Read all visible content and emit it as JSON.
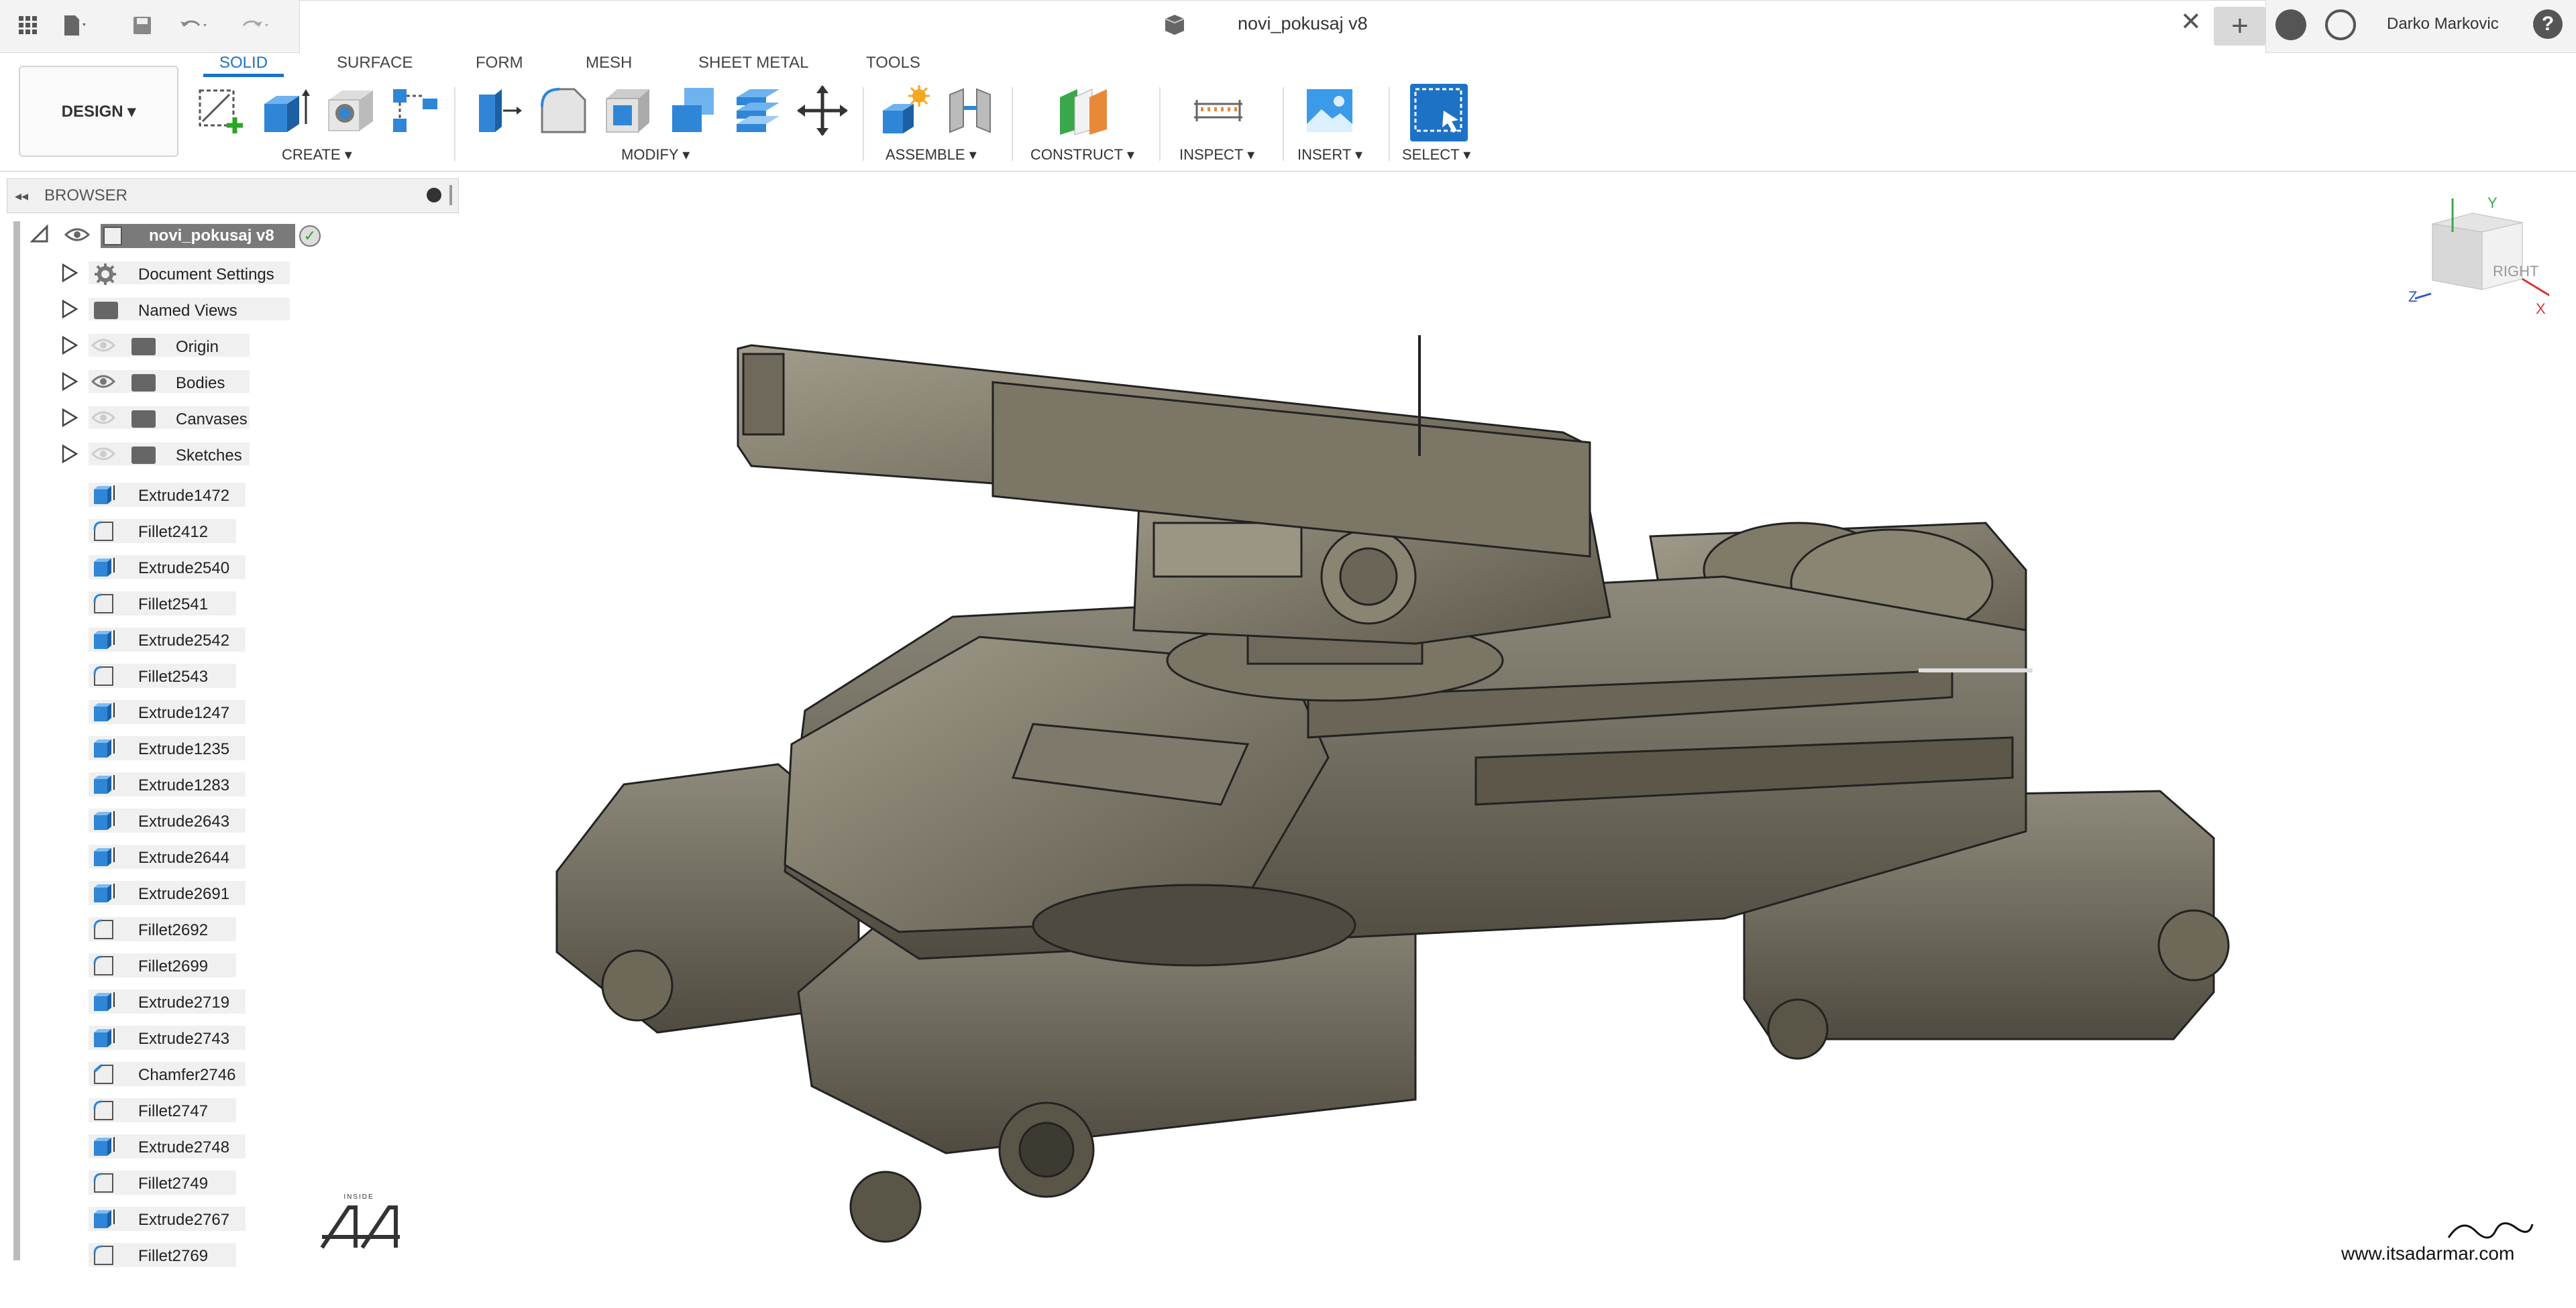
{
  "titlebar": {
    "document_title": "novi_pokusaj v8",
    "user_name": "Darko Markovic",
    "close_glyph": "✕",
    "add_glyph": "+",
    "help_glyph": "?"
  },
  "ribbon": {
    "workspace_label": "DESIGN ▾",
    "tabs": [
      "SOLID",
      "SURFACE",
      "FORM",
      "MESH",
      "SHEET METAL",
      "TOOLS"
    ],
    "active_tab": "SOLID",
    "groups": [
      "CREATE ▾",
      "MODIFY ▾",
      "ASSEMBLE ▾",
      "CONSTRUCT ▾",
      "INSPECT ▾",
      "INSERT ▾",
      "SELECT ▾"
    ]
  },
  "browser": {
    "title": "BROWSER",
    "root": "novi_pokusaj v8",
    "folders": [
      "Document Settings",
      "Named Views",
      "Origin",
      "Bodies",
      "Canvases",
      "Sketches"
    ],
    "features": [
      {
        "label": "Extrude1472",
        "type": "extrude"
      },
      {
        "label": "Fillet2412",
        "type": "fillet"
      },
      {
        "label": "Extrude2540",
        "type": "extrude"
      },
      {
        "label": "Fillet2541",
        "type": "fillet"
      },
      {
        "label": "Extrude2542",
        "type": "extrude"
      },
      {
        "label": "Fillet2543",
        "type": "fillet"
      },
      {
        "label": "Extrude1247",
        "type": "extrude"
      },
      {
        "label": "Extrude1235",
        "type": "extrude"
      },
      {
        "label": "Extrude1283",
        "type": "extrude"
      },
      {
        "label": "Extrude2643",
        "type": "extrude"
      },
      {
        "label": "Extrude2644",
        "type": "extrude"
      },
      {
        "label": "Extrude2691",
        "type": "extrude"
      },
      {
        "label": "Fillet2692",
        "type": "fillet"
      },
      {
        "label": "Fillet2699",
        "type": "fillet"
      },
      {
        "label": "Extrude2719",
        "type": "extrude"
      },
      {
        "label": "Extrude2743",
        "type": "extrude"
      },
      {
        "label": "Chamfer2746",
        "type": "chamfer"
      },
      {
        "label": "Fillet2747",
        "type": "fillet"
      },
      {
        "label": "Extrude2748",
        "type": "extrude"
      },
      {
        "label": "Fillet2749",
        "type": "fillet"
      },
      {
        "label": "Extrude2767",
        "type": "extrude"
      },
      {
        "label": "Fillet2769",
        "type": "fillet"
      }
    ]
  },
  "viewcube": {
    "face_label": "RIGHT",
    "axis_x": "X",
    "axis_y": "Y",
    "axis_z": "Z"
  },
  "watermark": {
    "url": "www.itsadarmar.com",
    "badge": "INSIDE"
  },
  "colors": {
    "accent": "#1e72c6",
    "model": "#6f6a5c",
    "extrude_icon": "#2f86d6"
  }
}
